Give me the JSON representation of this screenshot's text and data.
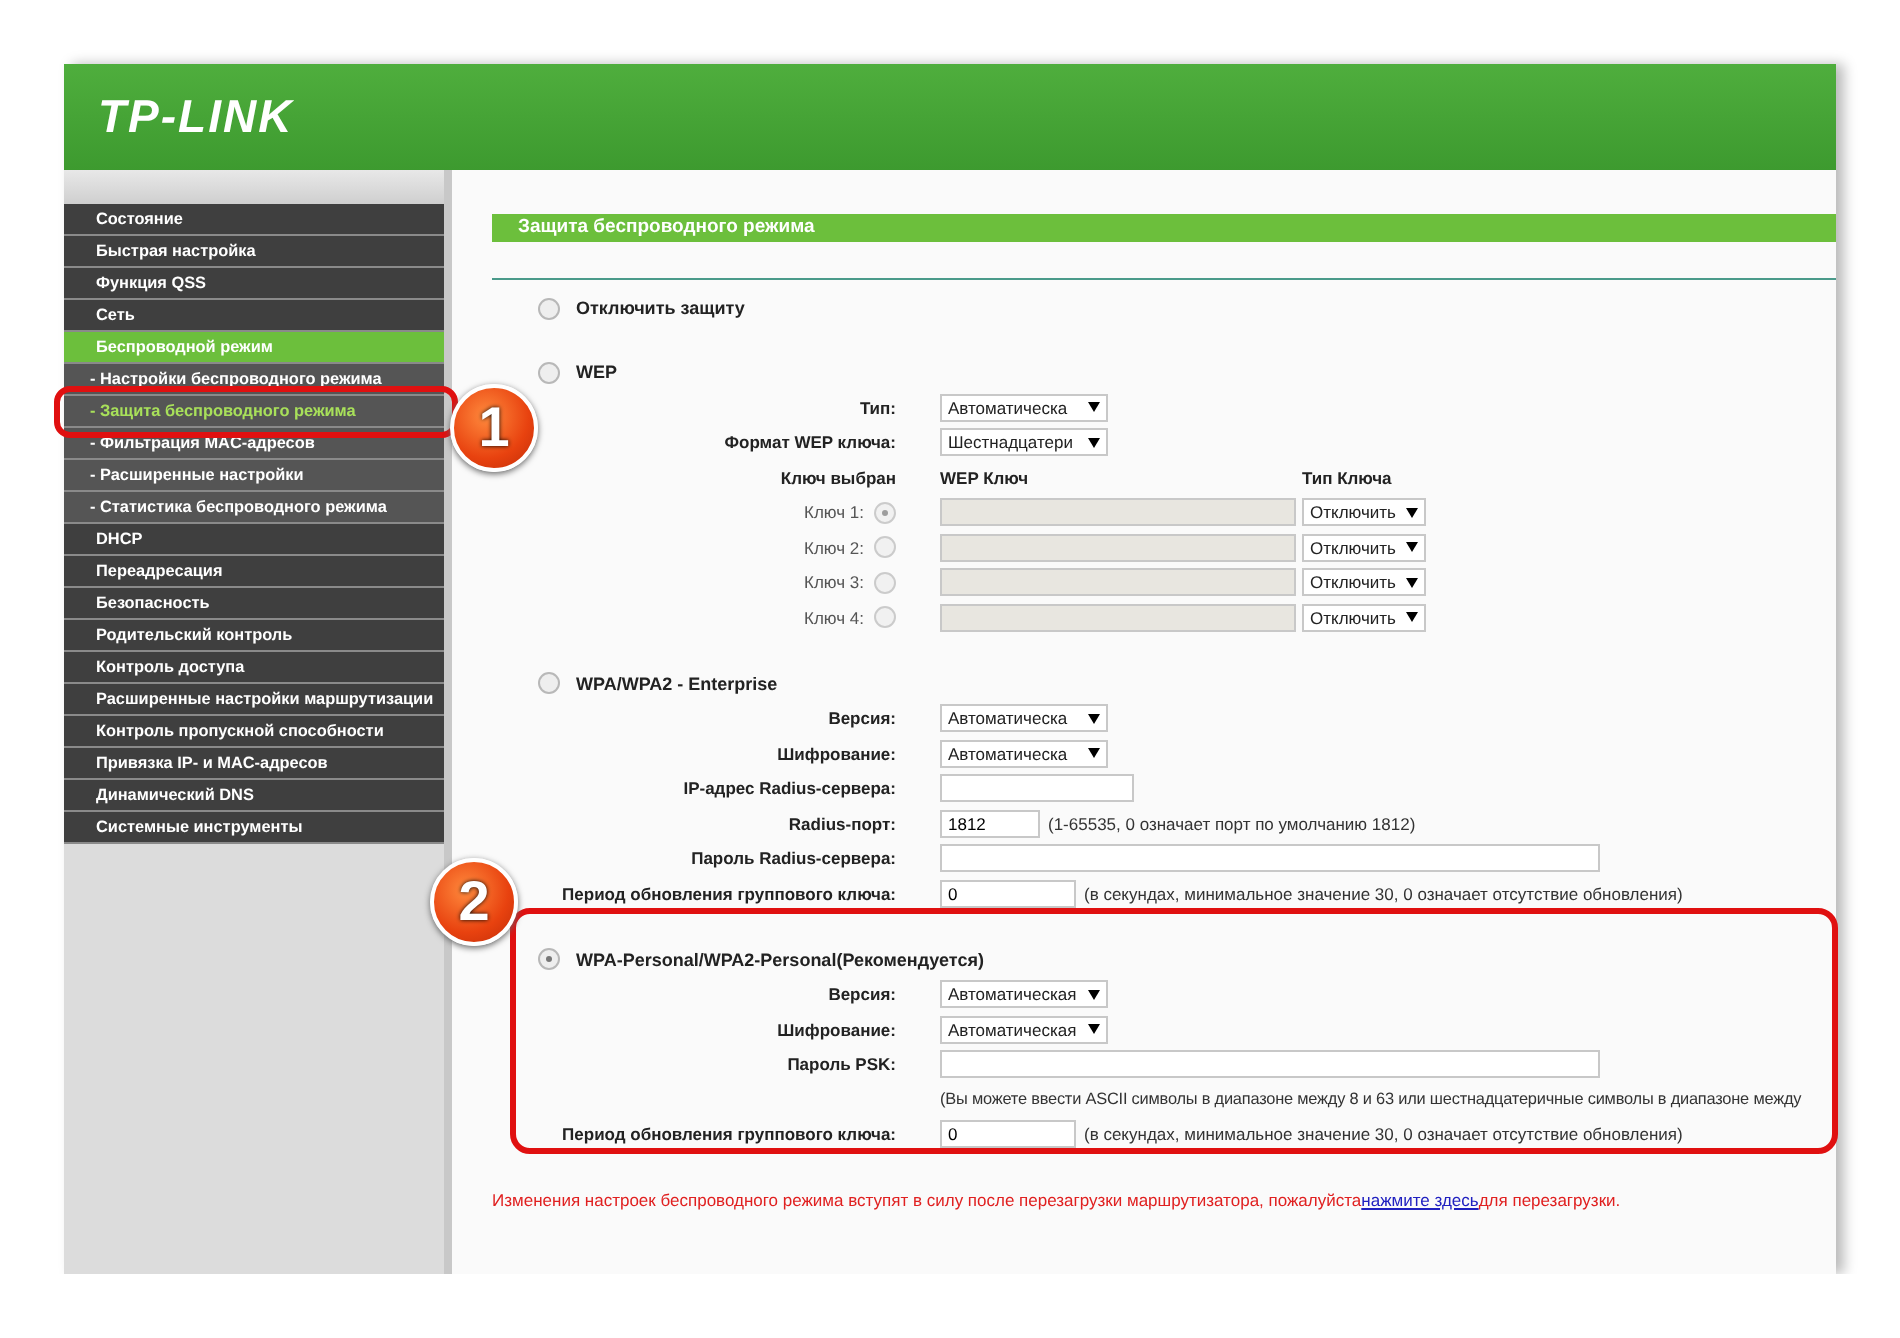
{
  "logo": "TP-LINK",
  "sidebar": {
    "items": [
      {
        "label": "Состояние",
        "selected": false
      },
      {
        "label": "Быстрая настройка",
        "selected": false
      },
      {
        "label": "Функция QSS",
        "selected": false
      },
      {
        "label": "Сеть",
        "selected": false
      },
      {
        "label": "Беспроводной режим",
        "selected": true,
        "children": [
          {
            "label": "- Настройки беспроводного режима",
            "selected": false
          },
          {
            "label": "- Защита беспроводного режима",
            "selected": true,
            "badge": "1"
          },
          {
            "label": "- Фильтрация MAC-адресов",
            "selected": false
          },
          {
            "label": "- Расширенные настройки",
            "selected": false
          },
          {
            "label": "- Статистика беспроводного режима",
            "selected": false
          }
        ]
      },
      {
        "label": "DHCP",
        "selected": false
      },
      {
        "label": "Переадресация",
        "selected": false
      },
      {
        "label": "Безопасность",
        "selected": false
      },
      {
        "label": "Родительский контроль",
        "selected": false
      },
      {
        "label": "Контроль доступа",
        "selected": false
      },
      {
        "label": "Расширенные настройки маршрутизации",
        "selected": false
      },
      {
        "label": "Контроль пропускной способности",
        "selected": false
      },
      {
        "label": "Привязка IP- и MAC-адресов",
        "selected": false
      },
      {
        "label": "Динамический DNS",
        "selected": false
      },
      {
        "label": "Системные инструменты",
        "selected": false
      }
    ]
  },
  "content": {
    "title": "Защита беспроводного режима",
    "modes": [
      {
        "label": "Отключить защиту",
        "selected": false
      },
      {
        "label": "WEP",
        "selected": false,
        "fields": [
          {
            "kind": "select",
            "label": "Тип:",
            "value": "Автоматическа"
          },
          {
            "kind": "select",
            "label": "Формат WEP ключа:",
            "value": "Шестнадцатери"
          },
          {
            "kind": "keys",
            "columns": [
              "Ключ выбран",
              "WEP Ключ",
              "Тип Ключа"
            ],
            "rows": [
              {
                "label": "Ключ 1:",
                "selected": true,
                "type": "Отключить"
              },
              {
                "label": "Ключ 2:",
                "selected": false,
                "type": "Отключить"
              },
              {
                "label": "Ключ 3:",
                "selected": false,
                "type": "Отключить"
              },
              {
                "label": "Ключ 4:",
                "selected": false,
                "type": "Отключить"
              }
            ]
          }
        ]
      },
      {
        "label": "WPA/WPA2 - Enterprise",
        "selected": false,
        "fields": [
          {
            "kind": "select",
            "label": "Версия:",
            "value": "Автоматическа"
          },
          {
            "kind": "select",
            "label": "Шифрование:",
            "value": "Автоматическа"
          },
          {
            "kind": "input",
            "label": "IP-адрес Radius-сервера:"
          },
          {
            "kind": "input",
            "label": "Radius-порт:",
            "value": "1812",
            "hint": "(1-65535, 0 означает порт по умолчанию 1812)"
          },
          {
            "kind": "input",
            "label": "Пароль Radius-сервера:"
          },
          {
            "kind": "input",
            "label": "Период обновления группового ключа:",
            "value": "0",
            "hint": "(в секундах, минимальное значение 30, 0 означает отсутствие обновления)"
          }
        ]
      },
      {
        "label": "WPA-Personal/WPA2-Personal(Рекомендуется)",
        "selected": true,
        "badge": "2",
        "fields": [
          {
            "kind": "select",
            "label": "Версия:",
            "value": "Автоматическая"
          },
          {
            "kind": "select",
            "label": "Шифрование:",
            "value": "Автоматическая"
          },
          {
            "kind": "input",
            "label": "Пароль PSK:"
          },
          {
            "kind": "note",
            "text": "(Вы можете ввести ASCII символы в диапазоне между 8 и 63 или шестнадцатеричные символы в диапазоне между"
          },
          {
            "kind": "input",
            "label": "Период обновления группового ключа:",
            "value": "0",
            "hint": "(в секундах, минимальное значение 30, 0 означает отсутствие обновления)"
          }
        ]
      }
    ],
    "footer": {
      "before": "Изменения настроек беспроводного режима вступят в силу после перезагрузки маршрутизатора, пожалуйста",
      "link": "нажмите здесь",
      "after": "для перезагрузки."
    }
  }
}
